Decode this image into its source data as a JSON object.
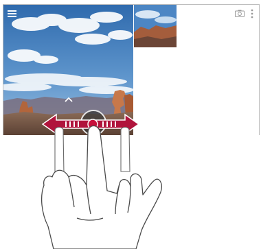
{
  "illustration": {
    "gesture": "swipe-left-right",
    "icons": {
      "menu": "hamburger-menu-icon",
      "camera": "camera-icon",
      "overflow": "overflow-menu-icon",
      "expand": "chevron-up-icon",
      "shutter": "shutter-button"
    },
    "colors": {
      "arrow": "#b0143c",
      "shutter_ring": "#e6e6e6",
      "touch_point": "#c8103c",
      "sky": "#3e78b8",
      "rock": "#b2653c"
    }
  }
}
